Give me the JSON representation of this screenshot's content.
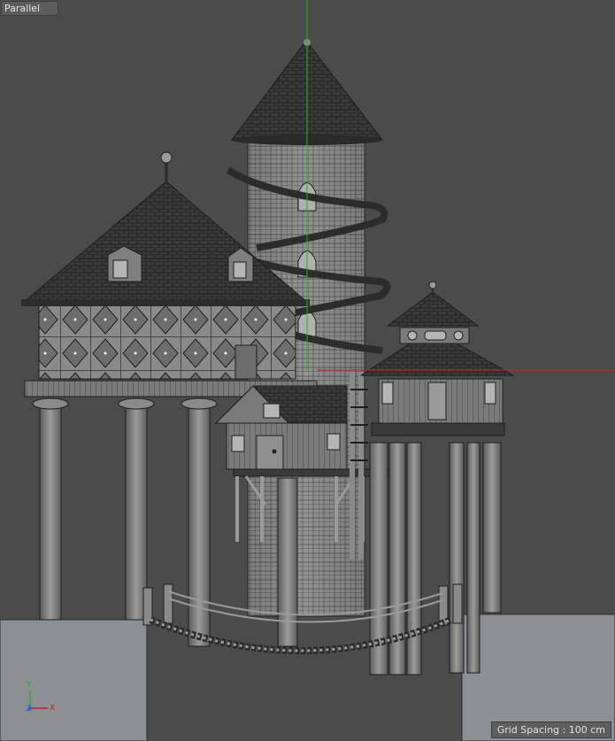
{
  "viewport": {
    "view_mode": "Parallel",
    "grid_spacing_text": "Grid Spacing : 100 cm"
  },
  "axis_gizmo": {
    "y_label": "Y",
    "z_label": "Z",
    "x_label": "X"
  },
  "colors": {
    "background": "#4b4b4b",
    "ground": "#8c8f94",
    "y_axis": "#21b521",
    "x_axis": "#c8201f",
    "z_axis": "#2f5bd6",
    "roof": "#2f2f2f",
    "wall": "#8a8a8a",
    "wire": "#1e1e1e"
  },
  "icons": [
    "axis-gizmo-icon"
  ]
}
